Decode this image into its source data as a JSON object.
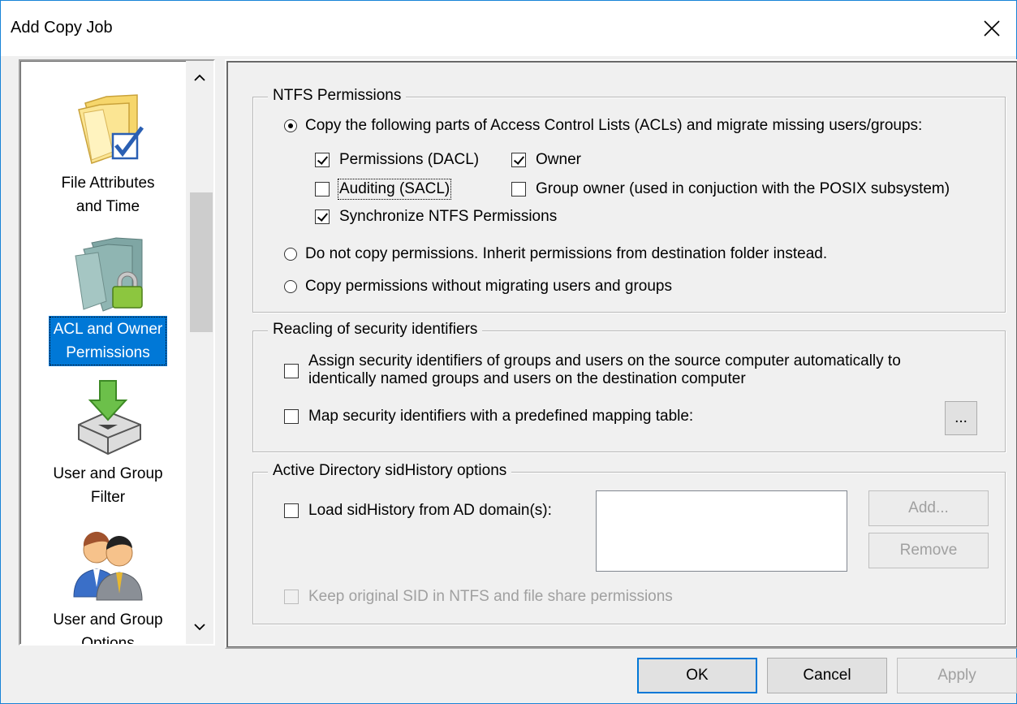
{
  "window": {
    "title": "Add Copy Job"
  },
  "nav": {
    "items": [
      {
        "label": "File Attributes\nand Time",
        "icon": "folder-check-icon"
      },
      {
        "label": "ACL and Owner\nPermissions",
        "icon": "lock-icon",
        "selected": true
      },
      {
        "label": "User and Group\nFilter",
        "icon": "filter-icon"
      },
      {
        "label": "User and Group\nOptions",
        "icon": "users-icon"
      }
    ]
  },
  "ntfs": {
    "title": "NTFS Permissions",
    "opt_copy": "Copy the following parts of Access Control Lists (ACLs) and migrate missing users/groups:",
    "permissions_dacl": "Permissions (DACL)",
    "owner": "Owner",
    "auditing_sacl": "Auditing (SACL)",
    "group_owner": "Group owner (used in conjuction with the POSIX subsystem)",
    "sync_ntfs": "Synchronize NTFS Permissions",
    "opt_inherit": "Do not copy permissions. Inherit permissions from destination folder instead.",
    "opt_no_migrate": "Copy permissions without migrating users and groups"
  },
  "realign": {
    "title": "Reacling of security identifiers",
    "assign_line1": "Assign security identifiers of groups and users on the source computer automatically to",
    "assign_line2": "identically named groups and users on the destination computer",
    "map": "Map security identifiers with a predefined mapping table:",
    "browse": "..."
  },
  "ad": {
    "title": "Active Directory sidHistory options",
    "load": "Load sidHistory from AD domain(s):",
    "add": "Add...",
    "remove": "Remove",
    "keep": "Keep original SID in NTFS and file share permissions"
  },
  "footer": {
    "ok": "OK",
    "cancel": "Cancel",
    "apply": "Apply"
  },
  "colors": {
    "selection": "#0078d7",
    "window_border": "#1883d7",
    "background": "#f0f0f0"
  }
}
